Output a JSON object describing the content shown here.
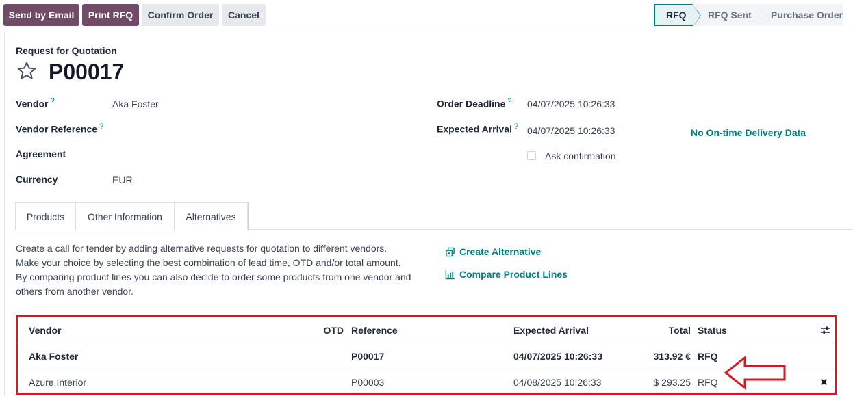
{
  "toolbar": {
    "send_by_email": "Send by Email",
    "print_rfq": "Print RFQ",
    "confirm_order": "Confirm Order",
    "cancel": "Cancel"
  },
  "statusbar": {
    "stages": [
      "RFQ",
      "RFQ Sent",
      "Purchase Order"
    ],
    "active_stage": "RFQ"
  },
  "header": {
    "subtitle": "Request for Quotation",
    "title": "P00017"
  },
  "fields": {
    "vendor_label": "Vendor",
    "vendor_value": "Aka Foster",
    "vendor_reference_label": "Vendor Reference",
    "agreement_label": "Agreement",
    "currency_label": "Currency",
    "currency_value": "EUR",
    "order_deadline_label": "Order Deadline",
    "order_deadline_value": "04/07/2025 10:26:33",
    "expected_arrival_label": "Expected Arrival",
    "expected_arrival_value": "04/07/2025 10:26:33",
    "on_time_delivery": "No On-time Delivery Data",
    "ask_confirmation_label": "Ask confirmation",
    "help_mark": "?"
  },
  "tabs": [
    "Products",
    "Other Information",
    "Alternatives"
  ],
  "alternatives": {
    "description": [
      "Create a call for tender by adding alternative requests for quotation to different vendors.",
      "Make your choice by selecting the best combination of lead time, OTD and/or total amount.",
      "By comparing product lines you can also decide to order some products from one vendor and",
      "others from another vendor."
    ],
    "create_alternative": "Create Alternative",
    "compare_product_lines": "Compare Product Lines",
    "columns": {
      "vendor": "Vendor",
      "otd": "OTD",
      "reference": "Reference",
      "expected_arrival": "Expected Arrival",
      "total": "Total",
      "status": "Status"
    },
    "rows": [
      {
        "vendor": "Aka Foster",
        "reference": "P00017",
        "expected_arrival": "04/07/2025 10:26:33",
        "total": "313.92 €",
        "status": "RFQ"
      },
      {
        "vendor": "Azure Interior",
        "reference": "P00003",
        "expected_arrival": "04/08/2025 10:26:33",
        "total": "$ 293.25",
        "status": "RFQ"
      }
    ]
  },
  "colors": {
    "primary": "#714b67",
    "accent": "#017e84",
    "highlight": "#e0141e"
  }
}
